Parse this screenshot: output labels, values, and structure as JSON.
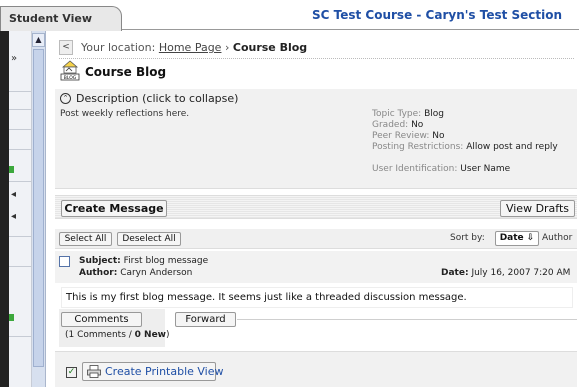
{
  "header": {
    "student_view_tab": "Student View",
    "course_title": "SC Test Course - Caryn's Test Section"
  },
  "location": {
    "prefix": "Your location:",
    "home_link": "Home Page",
    "separator": "›",
    "current": "Course Blog"
  },
  "page": {
    "title": "Course Blog",
    "icon_label": "BLOG"
  },
  "description": {
    "header": "Description (click to collapse)",
    "text": "Post weekly reflections here.",
    "meta": [
      {
        "label": "Topic Type:",
        "value": "Blog"
      },
      {
        "label": "Graded:",
        "value": "No"
      },
      {
        "label": "Peer Review:",
        "value": "No"
      },
      {
        "label": "Posting Restrictions:",
        "value": "Allow post and reply"
      },
      {
        "label": "User Identification:",
        "value": "User Name"
      }
    ]
  },
  "actions": {
    "create_message": "Create Message",
    "view_drafts": "View Drafts"
  },
  "list_controls": {
    "select_all": "Select All",
    "deselect_all": "Deselect All",
    "sort_by": "Sort by:",
    "sort_date": "Date ⇩",
    "sort_author": "Author"
  },
  "message": {
    "subject_label": "Subject:",
    "subject": "First blog message",
    "author_label": "Author:",
    "author": "Caryn Anderson",
    "date_label": "Date:",
    "date": "July 16, 2007 7:20 AM",
    "body": "This is my first blog message. It seems just like a threaded discussion message.",
    "comments_button": "Comments",
    "forward_button": "Forward",
    "comments_count_prefix": "(1 Comments / ",
    "comments_new": "0 New",
    "comments_count_suffix": ")"
  },
  "printable": {
    "label": "Create Printable View"
  },
  "icons": [
    "chevron-left-icon",
    "blog-icon",
    "collapse-icon",
    "scroll-up-icon",
    "checkbox-icon",
    "printer-icon",
    "print-check-icon",
    "expand-icon"
  ],
  "colors": {
    "title_blue": "#1f4fa5",
    "panel_gray": "#f1f1f1",
    "rail_dark": "#222222"
  }
}
